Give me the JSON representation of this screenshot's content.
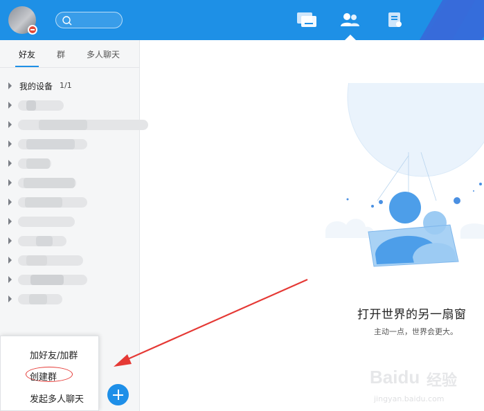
{
  "header": {
    "nav": [
      {
        "name": "messages"
      },
      {
        "name": "contacts",
        "active": true
      },
      {
        "name": "apps"
      }
    ]
  },
  "sidebar": {
    "tabs": [
      {
        "label": "好友",
        "active": true
      },
      {
        "label": "群",
        "active": false
      },
      {
        "label": "多人聊天",
        "active": false
      }
    ],
    "groups": [
      {
        "name": "我的设备",
        "count": "1/1"
      }
    ]
  },
  "popup_menu": {
    "items": [
      {
        "label": "加好友/加群"
      },
      {
        "label": "创建群",
        "highlighted": true
      },
      {
        "label": "发起多人聊天"
      }
    ]
  },
  "main": {
    "title": "打开世界的另一扇窗",
    "subtitle": "主动一点，世界会更大。"
  },
  "watermark": {
    "brand": "Baidu",
    "brand_cn": "经验",
    "domain": "jingyan.baidu.com"
  },
  "colors": {
    "header_bg": "#1e90e6",
    "accent": "#1e8fe8",
    "annotation_red": "#e53935"
  }
}
